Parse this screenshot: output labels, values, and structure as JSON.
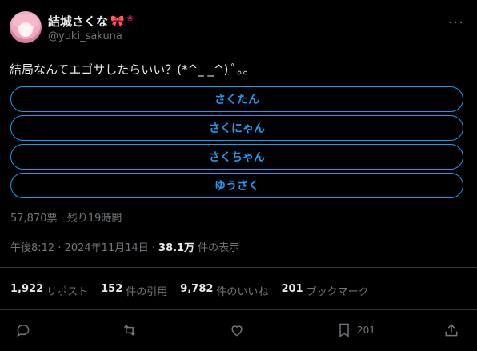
{
  "author": {
    "display_name": "結城さくな",
    "handle": "@yuki_sakuna",
    "emoji": [
      "ribbon-icon",
      "paw-icon"
    ]
  },
  "tweet": {
    "text": "結局なんてエゴサしたらいい？(*^_ _^) ﾟ｡｡"
  },
  "poll": {
    "options": [
      "さくたん",
      "さくにゃん",
      "さくちゃん",
      "ゆうさく"
    ],
    "meta": "57,870票 · 残り19時間"
  },
  "timestamp": {
    "time": "午後8:12 · 2024年11月14日 ·",
    "views_count": "38.1万",
    "views_label": "件の表示"
  },
  "stats": [
    {
      "count": "1,922",
      "label": "リポスト"
    },
    {
      "count": "152",
      "label": "件の引用"
    },
    {
      "count": "9,782",
      "label": "件のいいね"
    },
    {
      "count": "201",
      "label": "ブックマーク"
    }
  ],
  "actions": {
    "reply": "",
    "repost": "",
    "like": "",
    "bookmark_count": "201",
    "share": ""
  },
  "colors": {
    "background": "#000000",
    "accent": "#1d9bf0",
    "text": "#e7e9ea",
    "muted": "#71767b",
    "divider": "#2f3336"
  }
}
